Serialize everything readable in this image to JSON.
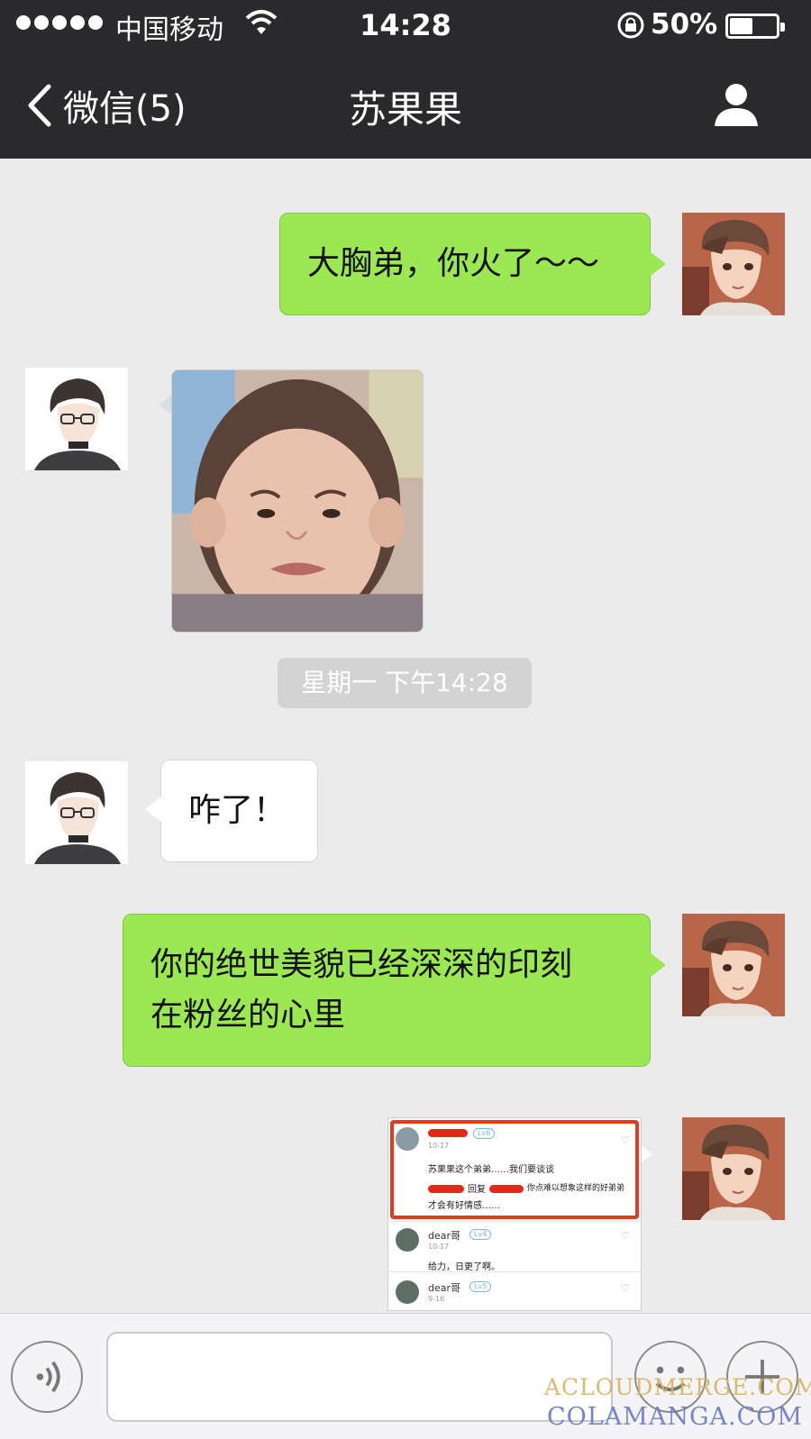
{
  "status_bar": {
    "carrier": "中国移动",
    "time": "14:28",
    "battery": "50%",
    "battery_level": 0.5,
    "signal_dots": 5
  },
  "nav": {
    "back_label": "微信(5)",
    "title": "苏果果"
  },
  "messages": [
    {
      "sender": "me",
      "type": "text",
      "text": "大胸弟，你火了～～"
    },
    {
      "sender": "contact",
      "type": "image",
      "description": "sticker"
    },
    {
      "type": "timestamp",
      "text": "星期一 下午14:28"
    },
    {
      "sender": "contact",
      "type": "text",
      "text": "咋了！"
    },
    {
      "sender": "me",
      "type": "text",
      "lines": [
        "你的绝世美貌已经深深的印刻",
        "在粉丝的心里"
      ]
    },
    {
      "sender": "me",
      "type": "screenshot"
    }
  ],
  "screenshot": {
    "comment1": {
      "date": "10-17",
      "badge": "Lv6",
      "text": "苏果果这个弟弟……我们要谈谈",
      "reply_prefix": "回复",
      "reply_text": "你点难以想象这样的好弟弟",
      "reply_text2": "才会有好情感……"
    },
    "comment2": {
      "name": "dear哥",
      "badge": "Lv4",
      "date": "10-17",
      "text": "给力，日更了啊。"
    },
    "comment3": {
      "name": "dear哥",
      "badge": "Lv5",
      "date": "9-16"
    }
  },
  "watermark": {
    "line1": "ACLOUDMERGE.COM",
    "line2": "COLAMANGA.COM"
  },
  "colors": {
    "nav_bg": "#2a2a2d",
    "chat_bg": "#ebebeb",
    "out_bubble": "#9be853",
    "in_bubble": "#ffffff",
    "highlight": "#e8391d"
  },
  "icons": [
    "chevron-left-icon",
    "profile-icon",
    "wifi-icon",
    "rotation-lock-icon",
    "battery-icon",
    "voice-icon",
    "emoji-icon",
    "plus-icon"
  ]
}
